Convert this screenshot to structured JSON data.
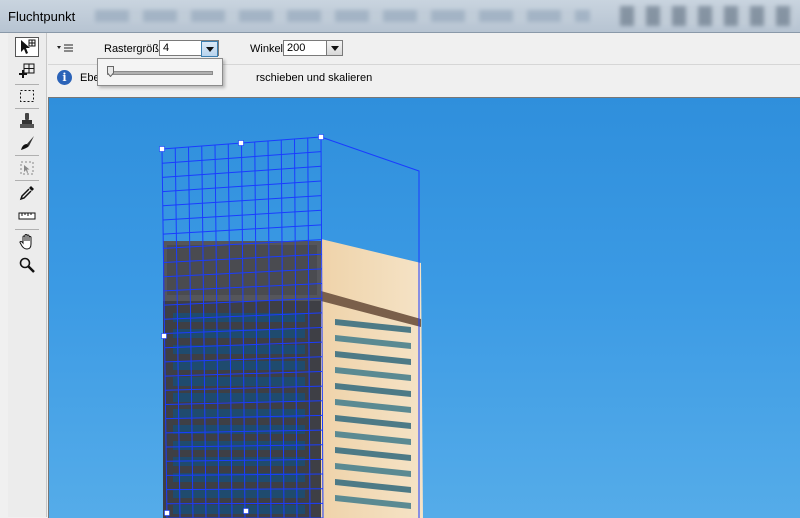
{
  "window": {
    "title": "Fluchtpunkt"
  },
  "toolbox": {
    "tools": [
      {
        "name": "edit-plane-tool"
      },
      {
        "name": "create-plane-tool"
      },
      {
        "name": "marquee-tool"
      },
      {
        "name": "stamp-tool"
      },
      {
        "name": "brush-tool"
      },
      {
        "name": "transform-tool"
      },
      {
        "name": "eyedropper-tool"
      },
      {
        "name": "measure-tool"
      },
      {
        "name": "hand-tool"
      },
      {
        "name": "zoom-tool"
      }
    ]
  },
  "options": {
    "grid_size_label": "Rastergröße:",
    "grid_size_value": "4",
    "angle_label": "Winkel:",
    "angle_value": "200"
  },
  "grid_slider": {
    "value_fraction": 0.02
  },
  "info": {
    "text_left": "Ebe",
    "text_right": "rschieben und skalieren"
  },
  "colors": {
    "grid_line": "#1a3cff",
    "sky": "#3b9ae4",
    "info_icon": "#2b63b8"
  }
}
